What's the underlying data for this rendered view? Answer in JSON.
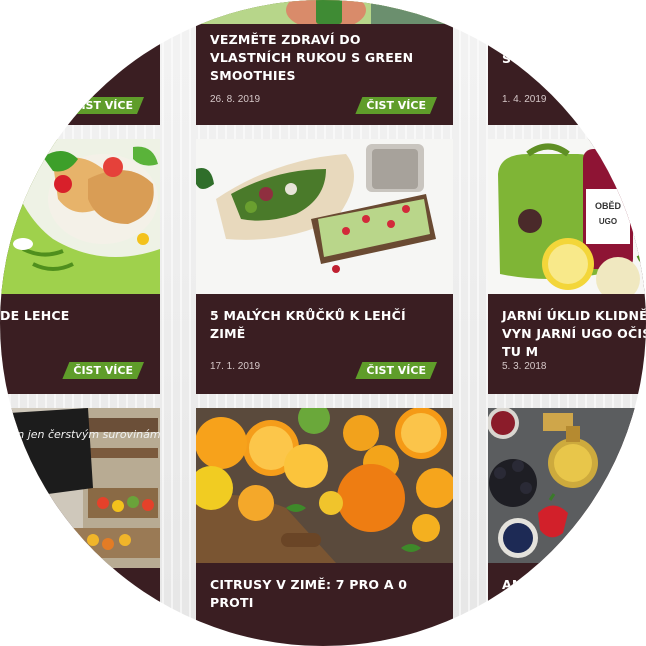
{
  "cards": [
    {
      "title": "",
      "date": "",
      "button": "ČIST VÍCE"
    },
    {
      "title": "VEZMĚTE ZDRAVÍ DO VLASTNÍCH RUKOU S GREEN SMOOTHIES",
      "date": "26. 8. 2019",
      "button": "ČIST VÍCE"
    },
    {
      "title": "S",
      "date": "1. 4. 2019",
      "button": ""
    },
    {
      "title": "DE LEHCE",
      "date": "",
      "button": "ČIST VÍCE"
    },
    {
      "title": "5 MALÝCH KRŮČKŮ K LEHČÍ ZIMĚ",
      "date": "17. 1. 2019",
      "button": "ČIST VÍCE"
    },
    {
      "title": "JARNÍ ÚKLID KLIDNĚ VYN JARNÍ UGO OČISTU? TU M",
      "date": "5. 3. 2018",
      "button": ""
    },
    {
      "title": "",
      "date": "",
      "button": ""
    },
    {
      "title": "CITRUSY V ZIMĚ: 7 PRO A 0 PROTI",
      "date": "",
      "button": ""
    },
    {
      "title": "AN",
      "date": "",
      "button": ""
    }
  ],
  "image_text": {
    "chalkboard": "Vstup povolen jen čerstvým surovinám",
    "bag_label": "OBĚD",
    "bag_logo": "UGO"
  },
  "colors": {
    "card_bg": "#3a1e22",
    "button_bg": "#5f9d2a"
  }
}
